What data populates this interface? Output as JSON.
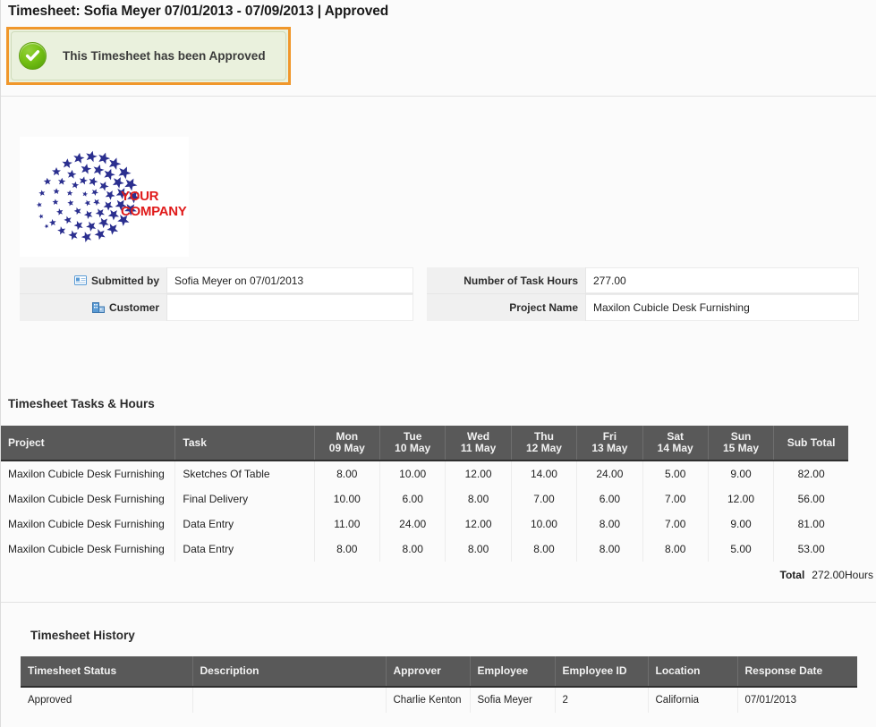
{
  "page": {
    "title": "Timesheet: Sofia Meyer 07/01/2013 - 07/09/2013 | Approved"
  },
  "banner": {
    "message": "This Timesheet has been Approved",
    "icon": "check-circle-icon",
    "border_color": "#f0972b",
    "background_color": "#eaf1dd",
    "icon_color": "#76c115"
  },
  "logo": {
    "word_line1": "YOUR",
    "word_line2": "COMPANY",
    "word_color": "#e01b1b",
    "star_color": "#2b2f8f"
  },
  "info": {
    "left": [
      {
        "icon": "id-card-icon",
        "label": "Submitted by",
        "value": "Sofia Meyer on 07/01/2013"
      },
      {
        "icon": "building-icon",
        "label": "Customer",
        "value": ""
      }
    ],
    "right": [
      {
        "label": "Number of Task Hours",
        "value": "277.00"
      },
      {
        "label": "Project Name",
        "value": "Maxilon Cubicle Desk Furnishing"
      }
    ]
  },
  "tasks_section": {
    "heading": "Timesheet Tasks & Hours",
    "columns": [
      {
        "label": "Project",
        "align": "left"
      },
      {
        "label": "Task",
        "align": "left"
      },
      {
        "label": "Mon\n09 May",
        "day": "Mon",
        "date": "09 May",
        "align": "center"
      },
      {
        "label": "Tue\n10 May",
        "day": "Tue",
        "date": "10 May",
        "align": "center"
      },
      {
        "label": "Wed\n11 May",
        "day": "Wed",
        "date": "11 May",
        "align": "center"
      },
      {
        "label": "Thu\n12 May",
        "day": "Thu",
        "date": "12 May",
        "align": "center"
      },
      {
        "label": "Fri\n13 May",
        "day": "Fri",
        "date": "13 May",
        "align": "center"
      },
      {
        "label": "Sat\n14 May",
        "day": "Sat",
        "date": "14 May",
        "align": "center"
      },
      {
        "label": "Sun\n15 May",
        "day": "Sun",
        "date": "15 May",
        "align": "center"
      },
      {
        "label": "Sub Total",
        "align": "center"
      }
    ],
    "rows": [
      {
        "project": "Maxilon Cubicle Desk Furnishing",
        "task": "Sketches Of Table",
        "mon": "8.00",
        "tue": "10.00",
        "wed": "12.00",
        "thu": "14.00",
        "fri": "24.00",
        "sat": "5.00",
        "sun": "9.00",
        "sub_total": "82.00"
      },
      {
        "project": "Maxilon Cubicle Desk Furnishing",
        "task": "Final Delivery",
        "mon": "10.00",
        "tue": "6.00",
        "wed": "8.00",
        "thu": "7.00",
        "fri": "6.00",
        "sat": "7.00",
        "sun": "12.00",
        "sub_total": "56.00"
      },
      {
        "project": "Maxilon Cubicle Desk Furnishing",
        "task": "Data Entry",
        "mon": "11.00",
        "tue": "24.00",
        "wed": "12.00",
        "thu": "10.00",
        "fri": "8.00",
        "sat": "7.00",
        "sun": "9.00",
        "sub_total": "81.00"
      },
      {
        "project": "Maxilon Cubicle Desk Furnishing",
        "task": "Data Entry",
        "mon": "8.00",
        "tue": "8.00",
        "wed": "8.00",
        "thu": "8.00",
        "fri": "8.00",
        "sat": "8.00",
        "sun": "5.00",
        "sub_total": "53.00"
      }
    ],
    "total_label": "Total",
    "total_value": "272.00Hours"
  },
  "history_section": {
    "heading": "Timesheet History",
    "columns": [
      {
        "label": "Timesheet Status"
      },
      {
        "label": "Description"
      },
      {
        "label": "Approver"
      },
      {
        "label": "Employee"
      },
      {
        "label": "Employee ID"
      },
      {
        "label": "Location"
      },
      {
        "label": "Response Date"
      }
    ],
    "rows": [
      {
        "status": "Approved",
        "description": "",
        "approver": "Charlie Kenton",
        "employee": "Sofia Meyer",
        "employee_id": "2",
        "location": "California",
        "response_date": "07/01/2013"
      }
    ]
  }
}
